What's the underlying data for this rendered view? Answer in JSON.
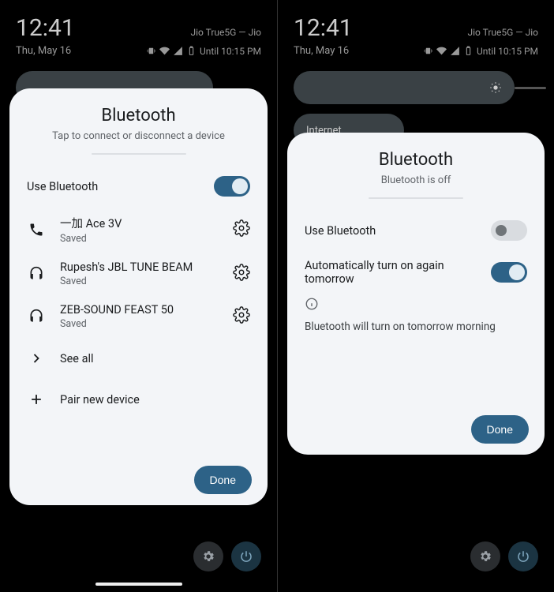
{
  "statusbar": {
    "time": "12:41",
    "carrier": "Jio True5G — Jio",
    "date": "Thu, May 16",
    "alarm": "Until 10:15 PM"
  },
  "qs": {
    "internet_label": "Internet"
  },
  "left": {
    "title": "Bluetooth",
    "subtitle": "Tap to connect or disconnect a device",
    "use_bt": "Use Bluetooth",
    "devices": [
      {
        "name": "一加 Ace 3V",
        "status": "Saved"
      },
      {
        "name": "Rupesh's JBL TUNE BEAM",
        "status": "Saved"
      },
      {
        "name": "ZEB-SOUND FEAST 50",
        "status": "Saved"
      }
    ],
    "see_all": "See all",
    "pair_new": "Pair new device",
    "done": "Done"
  },
  "right": {
    "title": "Bluetooth",
    "subtitle": "Bluetooth is off",
    "use_bt": "Use Bluetooth",
    "auto_on": "Automatically turn on again tomorrow",
    "info": "Bluetooth will turn on tomorrow morning",
    "done": "Done"
  }
}
